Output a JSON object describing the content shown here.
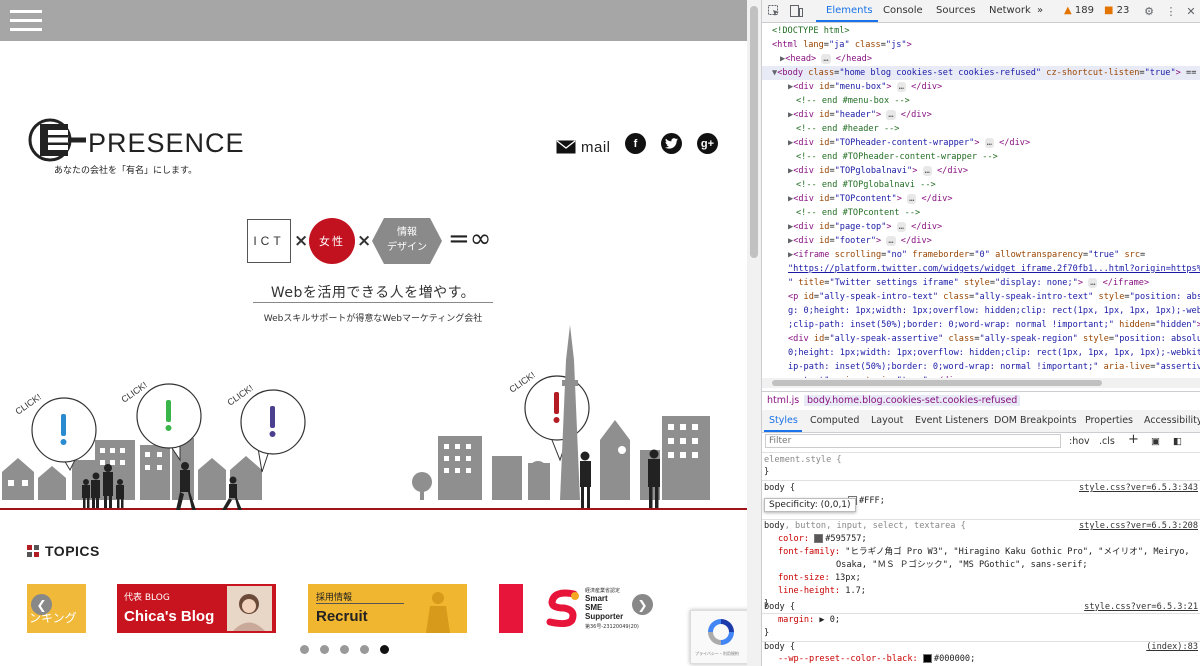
{
  "site": {
    "logo_text": "PRESENCE",
    "logo_sub": "あなたの会社を「有名」にします。",
    "mail_label": "mail",
    "social": {
      "facebook": "f",
      "twitter": "t",
      "google": "g+"
    },
    "equation": {
      "ict": "ICT",
      "women": "女性",
      "info_design": "情報\nデザイン",
      "infinity": "=∞"
    },
    "tagline": "Webを活用できる人を増やす。",
    "subtag": "Webスキルサポートが得意なWebマーケティング会社",
    "click_label": "CLICK!",
    "topics_title": "TOPICS",
    "banners": {
      "ranking": "ンキング",
      "blog_small": "代表 BLOG",
      "blog_title": "Chica's Blog",
      "recruit_small": "採用情報",
      "recruit_title": "Recruit",
      "sme_line1": "経済産業省認定",
      "sme_line2": "Smart",
      "sme_line3": "SME",
      "sme_line4": "Supporter",
      "sme_line5": "第36号-23120049(20)"
    },
    "recaptcha_text": "プライバシー・利用規約",
    "dots_count": 5,
    "active_dot": 5
  },
  "devtools": {
    "tabs": [
      "Elements",
      "Console",
      "Sources",
      "Network",
      "»"
    ],
    "active_tab": "Elements",
    "warnings": "189",
    "issues": "23",
    "dom_lines": [
      {
        "indent": 0,
        "html": "<span class='cmt'>&lt;!DOCTYPE html&gt;</span>"
      },
      {
        "indent": 0,
        "html": "<span class='tag'>&lt;html</span> <span class='attr'>lang</span>=<span class='val'>\"ja\"</span> <span class='attr'>class</span>=<span class='val'>\"js\"</span><span class='tag'>&gt;</span>"
      },
      {
        "indent": 1,
        "arrow": "▶",
        "html": "<span class='tag'>&lt;head&gt;</span> <span class='ell'>…</span> <span class='tag'>&lt;/head&gt;</span>"
      },
      {
        "indent": 0,
        "arrow": "▼",
        "html": "<span class='tag'>&lt;body</span> <span class='attr'>class</span>=<span class='val'>\"home blog cookies-set cookies-refused\"</span> <span class='attr'>cz-shortcut-listen</span>=<span class='val'>\"true\"</span><span class='tag'>&gt;</span> <span class='plain'>== $0</span>",
        "selected": true
      },
      {
        "indent": 2,
        "arrow": "▶",
        "html": "<span class='tag'>&lt;div</span> <span class='attr'>id</span>=<span class='val'>\"menu-box\"</span><span class='tag'>&gt;</span> <span class='ell'>…</span> <span class='tag'>&lt;/div&gt;</span>"
      },
      {
        "indent": 3,
        "html": "<span class='cmt'>&lt;!-- end #menu-box --&gt;</span>"
      },
      {
        "indent": 2,
        "arrow": "▶",
        "html": "<span class='tag'>&lt;div</span> <span class='attr'>id</span>=<span class='val'>\"header\"</span><span class='tag'>&gt;</span> <span class='ell'>…</span> <span class='tag'>&lt;/div&gt;</span>"
      },
      {
        "indent": 3,
        "html": "<span class='cmt'>&lt;!-- end #header --&gt;</span>"
      },
      {
        "indent": 2,
        "arrow": "▶",
        "html": "<span class='tag'>&lt;div</span> <span class='attr'>id</span>=<span class='val'>\"TOPheader-content-wrapper\"</span><span class='tag'>&gt;</span> <span class='ell'>…</span> <span class='tag'>&lt;/div&gt;</span>"
      },
      {
        "indent": 3,
        "html": "<span class='cmt'>&lt;!-- end #TOPheader-content-wrapper --&gt;</span>"
      },
      {
        "indent": 2,
        "arrow": "▶",
        "html": "<span class='tag'>&lt;div</span> <span class='attr'>id</span>=<span class='val'>\"TOPglobalnavi\"</span><span class='tag'>&gt;</span> <span class='ell'>…</span> <span class='tag'>&lt;/div&gt;</span>"
      },
      {
        "indent": 3,
        "html": "<span class='cmt'>&lt;!-- end #TOPglobalnavi --&gt;</span>"
      },
      {
        "indent": 2,
        "arrow": "▶",
        "html": "<span class='tag'>&lt;div</span> <span class='attr'>id</span>=<span class='val'>\"TOPcontent\"</span><span class='tag'>&gt;</span> <span class='ell'>…</span> <span class='tag'>&lt;/div&gt;</span>"
      },
      {
        "indent": 3,
        "html": "<span class='cmt'>&lt;!-- end #TOPcontent --&gt;</span>"
      },
      {
        "indent": 2,
        "arrow": "▶",
        "html": "<span class='tag'>&lt;div</span> <span class='attr'>id</span>=<span class='val'>\"page-top\"</span><span class='tag'>&gt;</span> <span class='ell'>…</span> <span class='tag'>&lt;/div&gt;</span>"
      },
      {
        "indent": 2,
        "arrow": "▶",
        "html": "<span class='tag'>&lt;div</span> <span class='attr'>id</span>=<span class='val'>\"footer\"</span><span class='tag'>&gt;</span> <span class='ell'>…</span> <span class='tag'>&lt;/div&gt;</span>"
      },
      {
        "indent": 2,
        "arrow": "▶",
        "html": "<span class='tag'>&lt;iframe</span> <span class='attr'>scrolling</span>=<span class='val'>\"no\"</span> <span class='attr'>frameborder</span>=<span class='val'>\"0\"</span> <span class='attr'>allowtransparency</span>=<span class='val'>\"true\"</span> <span class='attr'>src</span>="
      },
      {
        "indent": 2,
        "html": "<span class='link'>\"https://platform.twitter.com/widgets/widget_iframe.2f70fb1...html?origin=https%3A%2</span>"
      },
      {
        "indent": 2,
        "html": "<span class='val'>\"</span> <span class='attr'>title</span>=<span class='val'>\"Twitter settings iframe\"</span> <span class='attr'>style</span>=<span class='val'>\"display: none;\"</span><span class='tag'>&gt;</span> <span class='ell'>…</span> <span class='tag'>&lt;/iframe&gt;</span>"
      },
      {
        "indent": 2,
        "html": "<span class='tag'>&lt;p</span> <span class='attr'>id</span>=<span class='val'>\"ally-speak-intro-text\"</span> <span class='attr'>class</span>=<span class='val'>\"ally-speak-intro-text\"</span> <span class='attr'>style</span>=<span class='val'>\"position: absolut</span>"
      },
      {
        "indent": 2,
        "html": "<span class='val'>g: 0;height: 1px;width: 1px;overflow: hidden;clip: rect(1px, 1px, 1px, 1px);-webkit-</span>"
      },
      {
        "indent": 2,
        "html": "<span class='val'>;clip-path: inset(50%);border: 0;word-wrap: normal !important;\"</span> <span class='attr'>hidden</span>=<span class='val'>\"hidden\"</span><span class='tag'>&gt;</span><span class='plain'>通知</span>"
      },
      {
        "indent": 2,
        "html": "<span class='tag'>&lt;div</span> <span class='attr'>id</span>=<span class='val'>\"ally-speak-assertive\"</span> <span class='attr'>class</span>=<span class='val'>\"ally-speak-region\"</span> <span class='attr'>style</span>=<span class='val'>\"position: absolute;m</span>"
      },
      {
        "indent": 2,
        "html": "<span class='val'>0;height: 1px;width: 1px;overflow: hidden;clip: rect(1px, 1px, 1px, 1px);-webkit-cl</span>"
      },
      {
        "indent": 2,
        "html": "<span class='val'>ip-path: inset(50%);border: 0;word-wrap: normal !important;\"</span> <span class='attr'>aria-live</span>=<span class='val'>\"assertive\"</span> <span class='attr'>a</span>"
      },
      {
        "indent": 2,
        "html": "<span class='val'>ns text\"</span> <span class='attr'>aria-atomic</span>=<span class='val'>\"true\"</span><span class='tag'>&gt;&lt;/div&gt;</span>"
      }
    ],
    "crumbs": [
      "html.js",
      "body.home.blog.cookies-set.cookies-refused"
    ],
    "subtabs": [
      "Styles",
      "Computed",
      "Layout",
      "Event Listeners",
      "DOM Breakpoints",
      "Properties",
      "Accessibility"
    ],
    "filter_placeholder": "Filter",
    "hov": ":hov",
    "cls": ".cls",
    "tooltip": "Specificity: (0,0,1)",
    "styles": {
      "element_style": "element.style {",
      "close": "}",
      "body1_selector": "body {",
      "body1_src": "style.css?ver=6.5.3:343",
      "body1_bg": "#FFF;",
      "body2_selector": "body",
      "body2_rest": ", button, input, select, textarea {",
      "body2_src": "style.css?ver=6.5.3:208",
      "color_prop": "color:",
      "color_val": "#595757;",
      "font_prop": "font-family:",
      "font_val1": "\"ヒラギノ角ゴ Pro W3\", \"Hiragino Kaku Gothic Pro\", \"メイリオ\", Meiryo,",
      "font_val2": "Osaka, \"ＭＳ Ｐゴシック\", \"MS PGothic\", sans-serif;",
      "fontsize_prop": "font-size:",
      "fontsize_val": "13px;",
      "lh_prop": "line-height:",
      "lh_val": "1.7;",
      "body3_selector": "body {",
      "body3_src": "style.css?ver=6.5.3:21",
      "margin_prop": "margin:",
      "margin_val": "▶ 0;",
      "body4_selector": "body {",
      "body4_src": "(index):83",
      "preset_prop": "--wp--preset--color--black:",
      "preset_val": "#000000;"
    }
  }
}
